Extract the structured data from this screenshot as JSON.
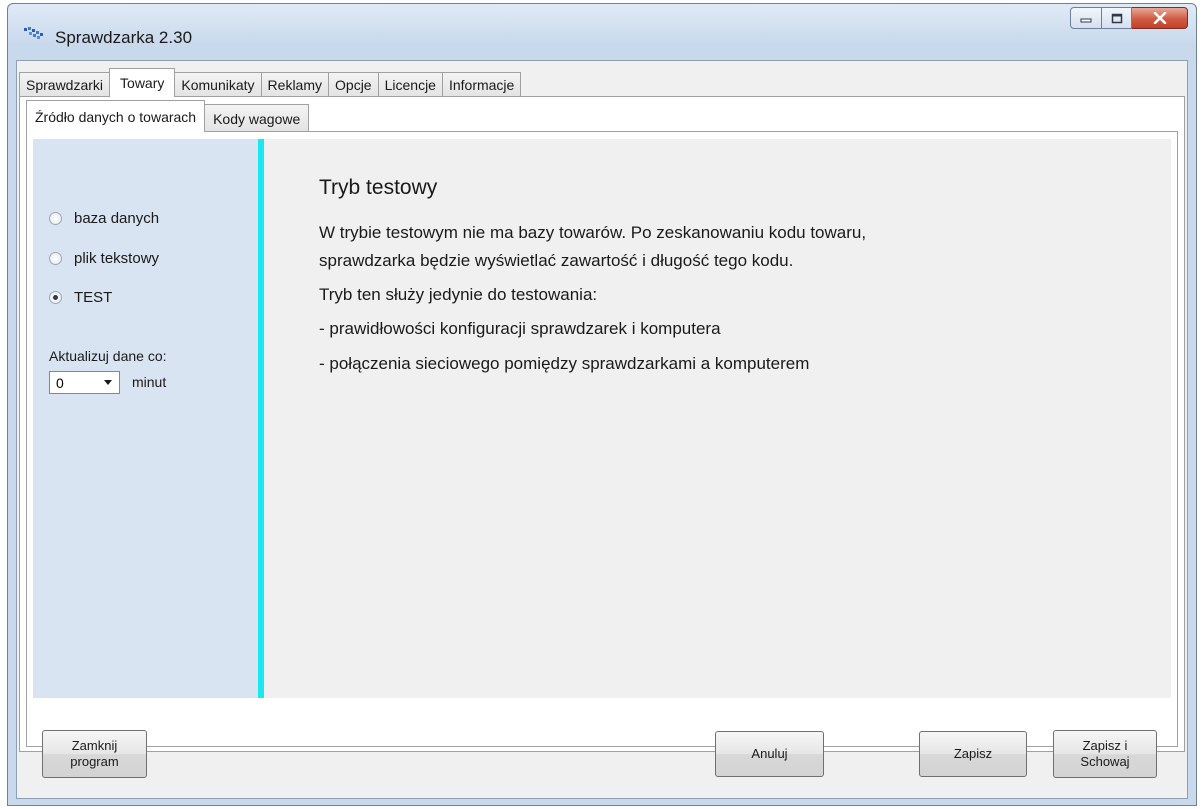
{
  "window": {
    "title": "Sprawdzarka 2.30"
  },
  "main_tabs": [
    {
      "label": "Sprawdzarki"
    },
    {
      "label": "Towary"
    },
    {
      "label": "Komunikaty"
    },
    {
      "label": "Reklamy"
    },
    {
      "label": "Opcje"
    },
    {
      "label": "Licencje"
    },
    {
      "label": "Informacje"
    }
  ],
  "sub_tabs": [
    {
      "label": "Źródło danych o towarach"
    },
    {
      "label": "Kody wagowe"
    }
  ],
  "source": {
    "options": [
      {
        "label": "baza danych",
        "selected": false
      },
      {
        "label": "plik tekstowy",
        "selected": false
      },
      {
        "label": "TEST",
        "selected": true
      }
    ],
    "update_label": "Aktualizuj dane co:",
    "update_value": "0",
    "update_unit": "minut"
  },
  "info": {
    "title": "Tryb testowy",
    "line1": "W trybie testowym nie ma bazy towarów. Po zeskanowaniu kodu towaru,",
    "line2": "sprawdzarka będzie wyświetlać zawartość i długość tego kodu.",
    "line3": "Tryb ten służy jedynie do testowania:",
    "line4": "- prawidłowości konfiguracji sprawdzarek i komputera",
    "line5": "- połączenia sieciowego pomiędzy sprawdzarkami a komputerem"
  },
  "buttons": {
    "close_line1": "Zamknij",
    "close_line2": "program",
    "cancel": "Anuluj",
    "save": "Zapisz",
    "save_hide_line1": "Zapisz i",
    "save_hide_line2": "Schowaj"
  },
  "colors": {
    "accent_bar": "#19e8f0",
    "left_panel": "#d8e4f1",
    "close_button": "#c34128"
  }
}
